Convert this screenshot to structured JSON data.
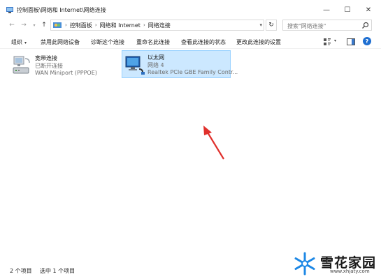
{
  "window": {
    "title": "控制面板\\网络和 Internet\\网络连接",
    "controls": {
      "minimize": "—",
      "maximize": "☐",
      "close": "✕"
    }
  },
  "nav": {
    "back": "←",
    "forward": "→",
    "recent": "▾",
    "up": "↑",
    "refresh": "↻"
  },
  "breadcrumb": [
    "控制面板",
    "网络和 Internet",
    "网络连接"
  ],
  "search": {
    "placeholder": "搜索\"网络连接\""
  },
  "commands": {
    "organize": "组织",
    "disable": "禁用此网络设备",
    "diagnose": "诊断这个连接",
    "rename": "重命名此连接",
    "status": "查看此连接的状态",
    "settings": "更改此连接的设置",
    "help": "?"
  },
  "connections": [
    {
      "name": "宽带连接",
      "status": "已断开连接",
      "device": "WAN Miniport (PPPOE)",
      "icon": "dialup-modem-icon",
      "selected": false
    },
    {
      "name": "以太网",
      "status": "网络 4",
      "device": "Realtek PCIe GBE Family Contr...",
      "icon": "ethernet-adapter-icon",
      "selected": true
    }
  ],
  "statusbar": {
    "count": "2 个项目",
    "selected": "选中 1 个项目"
  },
  "watermark": {
    "brand": "雪花家园",
    "url": "www.xhjaty.com"
  },
  "colors": {
    "selection_bg": "#cce8ff",
    "selection_border": "#99d1ff",
    "annotation_arrow": "#e0302c",
    "help_blue": "#1f6fd1"
  }
}
